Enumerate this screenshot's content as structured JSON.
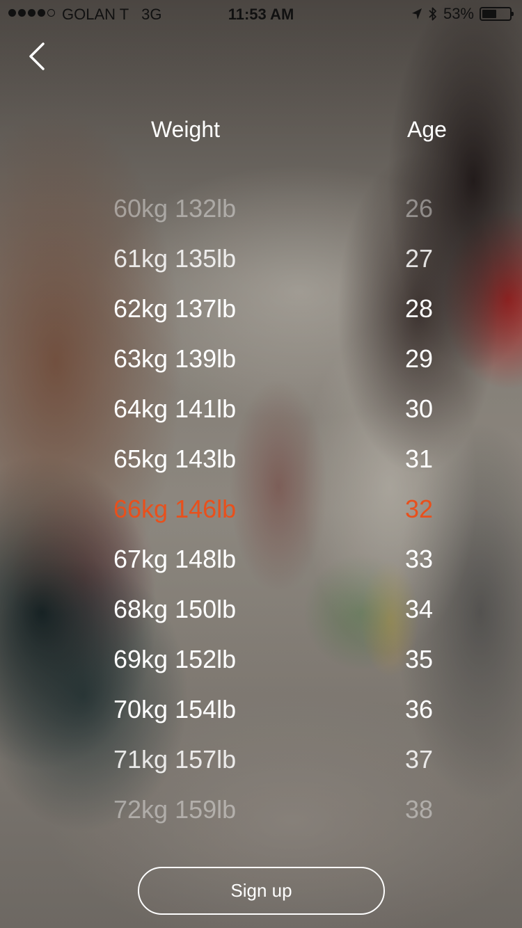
{
  "status_bar": {
    "carrier": "GOLAN T",
    "network": "3G",
    "time": "11:53 AM",
    "battery_percent_text": "53%",
    "battery_level": 0.53,
    "signal_bars_filled": 4,
    "signal_bars_total": 5,
    "icons": [
      "location-arrow-icon",
      "bluetooth-icon",
      "battery-icon"
    ]
  },
  "nav": {
    "back_icon": "chevron-left-icon"
  },
  "headers": {
    "weight": "Weight",
    "age": "Age"
  },
  "weight_options": [
    "60kg 132lb",
    "61kg 135lb",
    "62kg 137lb",
    "63kg 139lb",
    "64kg 141lb",
    "65kg 143lb",
    "66kg 146lb",
    "67kg 148lb",
    "68kg 150lb",
    "69kg 152lb",
    "70kg 154lb",
    "71kg 157lb",
    "72kg 159lb"
  ],
  "age_options": [
    "26",
    "27",
    "28",
    "29",
    "30",
    "31",
    "32",
    "33",
    "34",
    "35",
    "36",
    "37",
    "38"
  ],
  "selected": {
    "weight": "66kg 146lb",
    "age": "32"
  },
  "signup_label": "Sign up",
  "colors": {
    "accent": "#e8501c",
    "text": "#ffffff",
    "status_text": "#111111"
  }
}
